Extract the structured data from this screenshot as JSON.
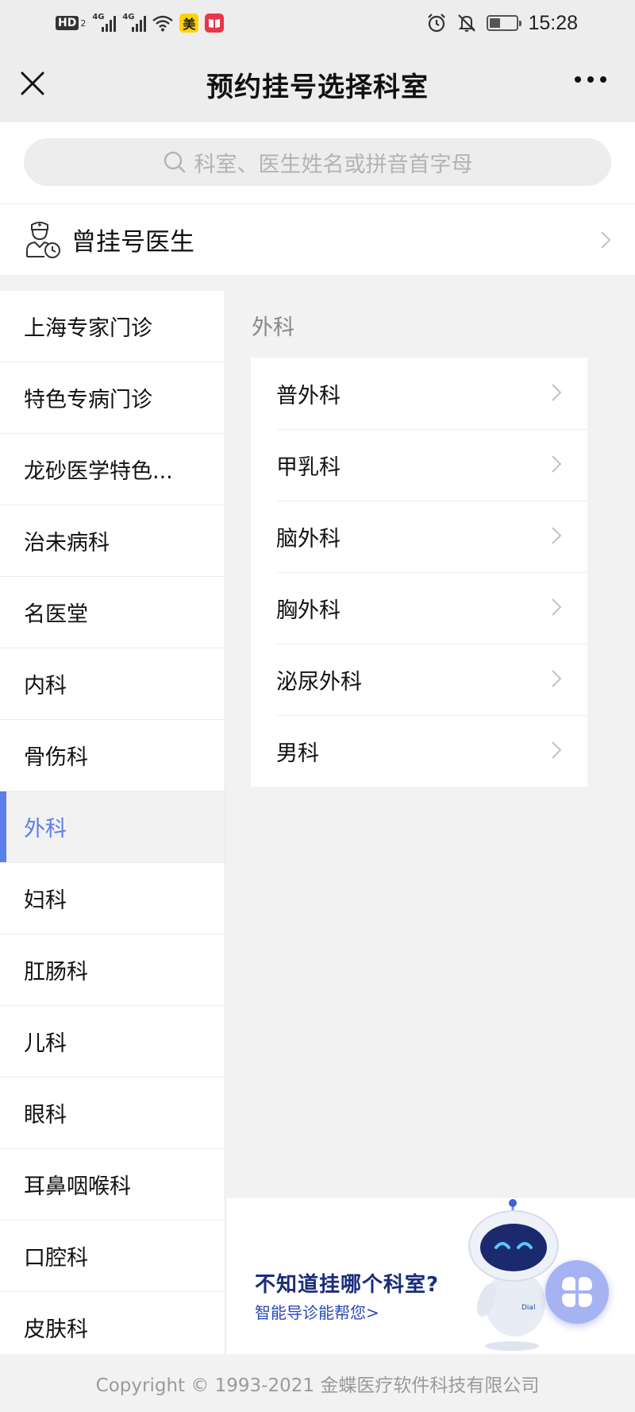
{
  "status_bar": {
    "hd": "HD",
    "hd_sub": "2",
    "net1": "4G",
    "net2": "4G",
    "app1": "美",
    "time": "15:28",
    "battery_level": 0.4
  },
  "nav": {
    "title": "预约挂号选择科室"
  },
  "search": {
    "placeholder": "科室、医生姓名或拼音首字母"
  },
  "prev_doctors": {
    "label": "曾挂号医生"
  },
  "sidebar": {
    "items": [
      {
        "label": "上海专家门诊"
      },
      {
        "label": "特色专病门诊"
      },
      {
        "label": "龙砂医学特色..."
      },
      {
        "label": "治未病科"
      },
      {
        "label": "名医堂"
      },
      {
        "label": "内科"
      },
      {
        "label": "骨伤科"
      },
      {
        "label": "外科"
      },
      {
        "label": "妇科"
      },
      {
        "label": "肛肠科"
      },
      {
        "label": "儿科"
      },
      {
        "label": "眼科"
      },
      {
        "label": "耳鼻咽喉科"
      },
      {
        "label": "口腔科"
      },
      {
        "label": "皮肤科"
      }
    ],
    "active_index": 7
  },
  "content": {
    "category_title": "外科",
    "departments": [
      {
        "label": "普外科"
      },
      {
        "label": "甲乳科"
      },
      {
        "label": "脑外科"
      },
      {
        "label": "胸外科"
      },
      {
        "label": "泌尿外科"
      },
      {
        "label": "男科"
      }
    ]
  },
  "guide": {
    "title": "不知道挂哪个科室?",
    "subtitle": "智能导诊能帮您>",
    "robot_label": "Dial"
  },
  "footer": {
    "text": "Copyright © 1993-2021 金蝶医疗软件科技有限公司"
  },
  "colors": {
    "accent": "#5b7fe8",
    "background": "#f2f2f2",
    "guide_title": "#1a2c7a"
  }
}
